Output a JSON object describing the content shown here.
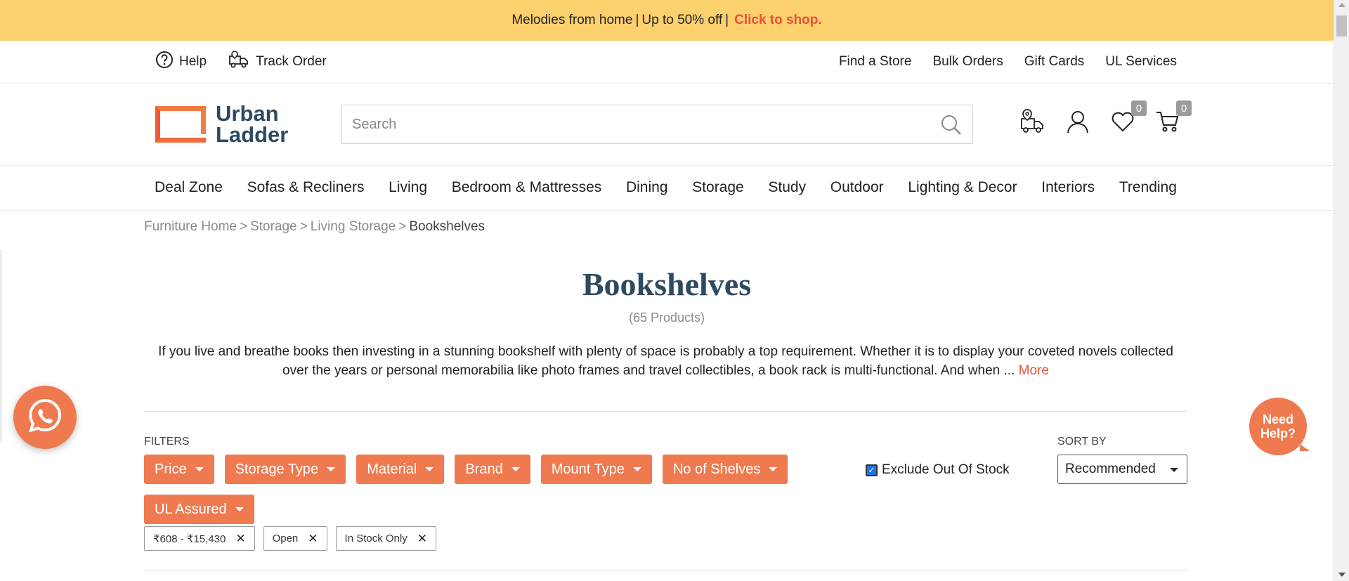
{
  "promo": {
    "text": "Melodies from home",
    "sep1": "|",
    "offer": "Up to 50% off",
    "sep2": "|",
    "cta": "Click to shop."
  },
  "utility": {
    "help": "Help",
    "track_order": "Track Order",
    "links": [
      "Find a Store",
      "Bulk Orders",
      "Gift Cards",
      "UL Services"
    ]
  },
  "header": {
    "logo_line1": "Urban",
    "logo_line2": "Ladder",
    "search_placeholder": "Search",
    "wishlist_count": "0",
    "cart_count": "0"
  },
  "nav": [
    "Deal Zone",
    "Sofas & Recliners",
    "Living",
    "Bedroom & Mattresses",
    "Dining",
    "Storage",
    "Study",
    "Outdoor",
    "Lighting & Decor",
    "Interiors",
    "Trending"
  ],
  "breadcrumb": {
    "items": [
      "Furniture Home",
      "Storage",
      "Living Storage"
    ],
    "separator": ">",
    "current": "Bookshelves"
  },
  "page": {
    "title": "Bookshelves",
    "count": "(65 Products)",
    "description": "If you live and breathe books then investing in a stunning bookshelf with plenty of space is probably a top requirement. Whether it is to display your coveted novels collected over the years or personal memorabilia like photo frames and travel collectibles, a book rack is multi-functional. And when ...",
    "more": "More"
  },
  "filters": {
    "label": "FILTERS",
    "chips": [
      "Price",
      "Storage Type",
      "Material",
      "Brand",
      "Mount Type",
      "No of Shelves",
      "UL Assured"
    ],
    "exclude_out_of_stock": "Exclude Out Of Stock",
    "exclude_checked": true,
    "applied": [
      "₹608 - ₹15,430",
      "Open",
      "In Stock Only"
    ]
  },
  "sort": {
    "label": "SORT BY",
    "value": "Recommended"
  },
  "need_help": {
    "line1": "Need",
    "line2": "Help?"
  },
  "colors": {
    "accent": "#ef7a4f",
    "promo_bg": "#fdd06e",
    "cta": "#e8513b",
    "title": "#2f4a60"
  }
}
